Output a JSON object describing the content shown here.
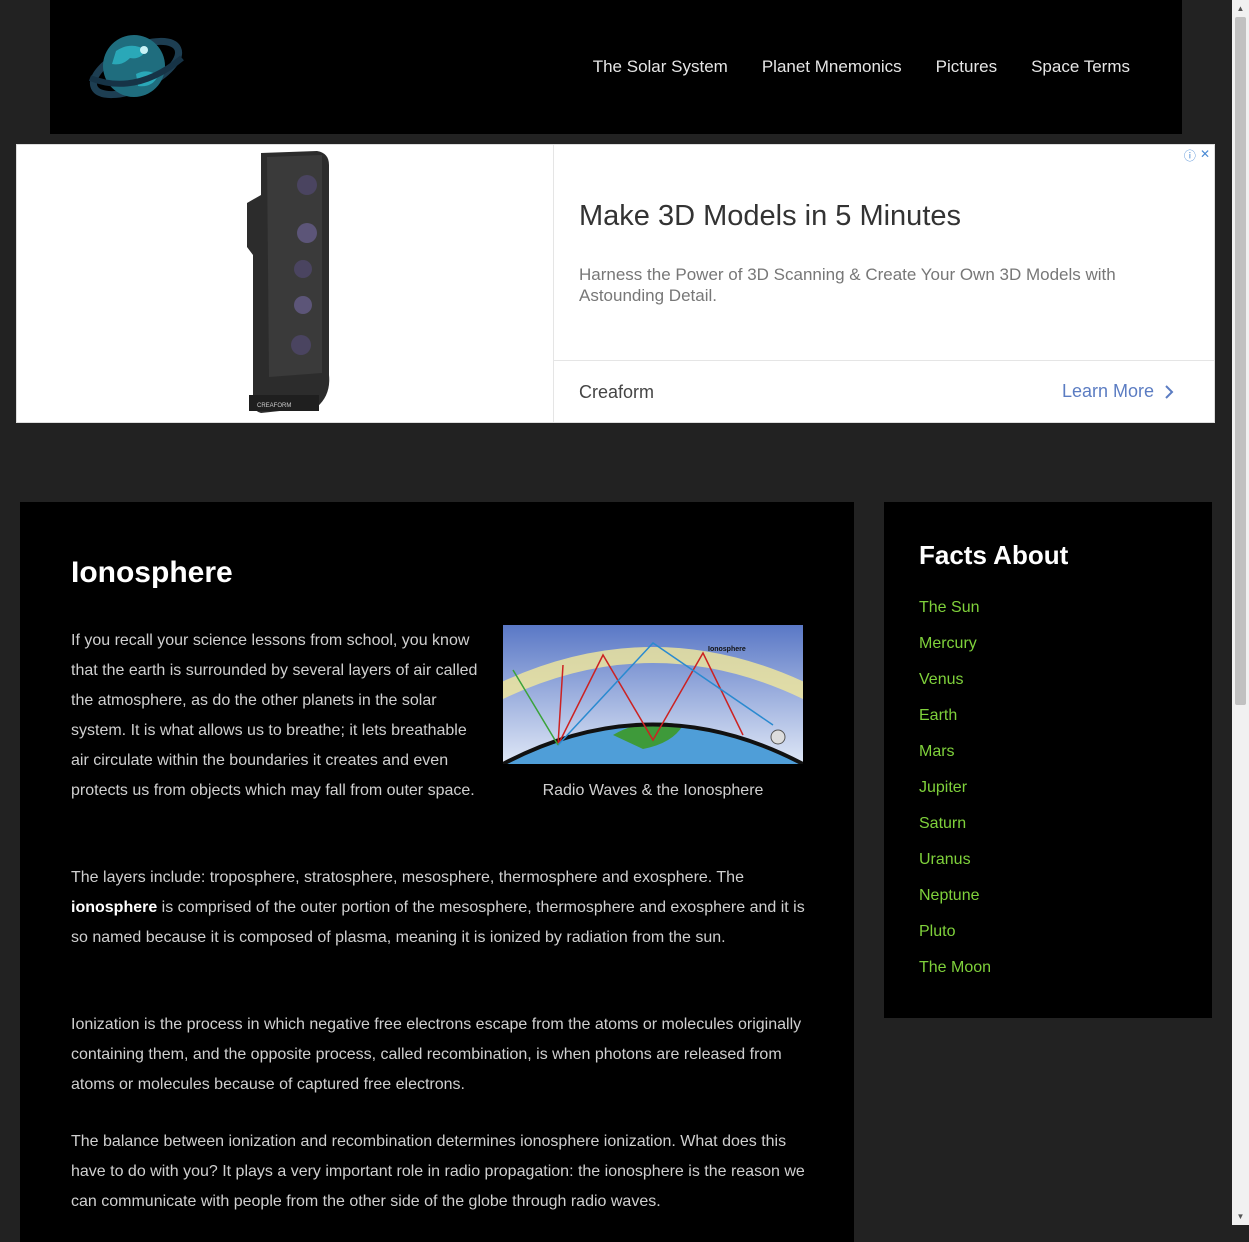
{
  "header": {
    "nav": [
      {
        "label": "The Solar System"
      },
      {
        "label": "Planet Mnemonics"
      },
      {
        "label": "Pictures"
      },
      {
        "label": "Space Terms"
      }
    ]
  },
  "ad": {
    "headline": "Make 3D Models in 5 Minutes",
    "description": "Harness the Power of 3D Scanning & Create Your Own 3D Models with Astounding Detail.",
    "brand": "Creaform",
    "cta": "Learn More",
    "device_label": "CREAFORM"
  },
  "article": {
    "title": "Ionosphere",
    "intro": "If you recall your science lessons from school, you know that the earth is surrounded by several layers of air called the atmosphere, as do the other planets in the solar system. It is what allows us to breathe; it lets breathable air circulate within the boundaries it creates and even protects us from objects which may fall from outer space.",
    "figure_label": "Ionosphere",
    "figure_caption": "Radio Waves & the Ionosphere",
    "p2_before": "The layers include: troposphere, stratosphere, mesosphere, thermosphere and exosphere. The ",
    "p2_bold": "ionosphere",
    "p2_after": " is comprised of the outer portion of the mesosphere, thermosphere and exosphere and it is so named because it is composed of plasma, meaning it is ionized by radiation from the sun.",
    "p3": "Ionization is the process in which negative free electrons escape from the atoms or molecules originally containing them, and the opposite process, called recombination, is when photons are released from atoms or molecules because of captured free electrons.",
    "p4": "The balance between ionization and recombination determines ionosphere ionization. What does this have to do with you? It plays a very important role in radio propagation: the ionosphere is the reason we can communicate with people from the other side of the globe through radio waves."
  },
  "sidebar": {
    "title": "Facts About",
    "items": [
      "The Sun",
      "Mercury",
      "Venus",
      "Earth",
      "Mars",
      "Jupiter",
      "Saturn",
      "Uranus",
      "Neptune",
      "Pluto",
      "The Moon"
    ]
  },
  "colors": {
    "link_green": "#7fd13b",
    "panel": "#000000",
    "page_bg": "#222222"
  }
}
